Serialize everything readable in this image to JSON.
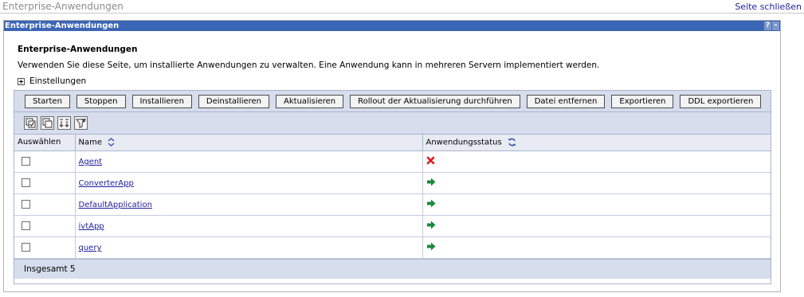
{
  "page": {
    "title": "Enterprise-Anwendungen",
    "close_link": "Seite schließen"
  },
  "portlet": {
    "title": "Enterprise-Anwendungen",
    "help_label": "?",
    "minimize_label": "–",
    "heading": "Enterprise-Anwendungen",
    "description": "Verwenden Sie diese Seite, um installierte Anwendungen zu verwalten. Eine Anwendung kann in mehreren Servern implementiert werden.",
    "settings_label": "Einstellungen"
  },
  "toolbar": {
    "buttons": [
      "Starten",
      "Stoppen",
      "Installieren",
      "Deinstallieren",
      "Aktualisieren",
      "Rollout der Aktualisierung durchführen",
      "Datei entfernen",
      "Exportieren",
      "DDL exportieren"
    ],
    "icons": [
      "select-all-icon",
      "deselect-all-icon",
      "show-filter-icon",
      "clear-filter-icon"
    ]
  },
  "table": {
    "headers": {
      "select": "Auswählen",
      "name": "Name",
      "status": "Anwendungsstatus"
    },
    "rows": [
      {
        "name": "Agent",
        "status": "stopped",
        "status_icon": "red-x-icon",
        "status_color": "#d81c1c"
      },
      {
        "name": "ConverterApp",
        "status": "started",
        "status_icon": "green-arrow-icon",
        "status_color": "#1a8a3a"
      },
      {
        "name": "DefaultApplication",
        "status": "started",
        "status_icon": "green-arrow-icon",
        "status_color": "#1a8a3a"
      },
      {
        "name": "ivtApp",
        "status": "started",
        "status_icon": "green-arrow-icon",
        "status_color": "#1a8a3a"
      },
      {
        "name": "query",
        "status": "started",
        "status_icon": "green-arrow-icon",
        "status_color": "#1a8a3a"
      }
    ],
    "total_label": "Insgesamt 5"
  },
  "colors": {
    "title_bar": "#3b65b5",
    "toolbar_bg": "#d6dded",
    "link": "#1d1d9c"
  }
}
